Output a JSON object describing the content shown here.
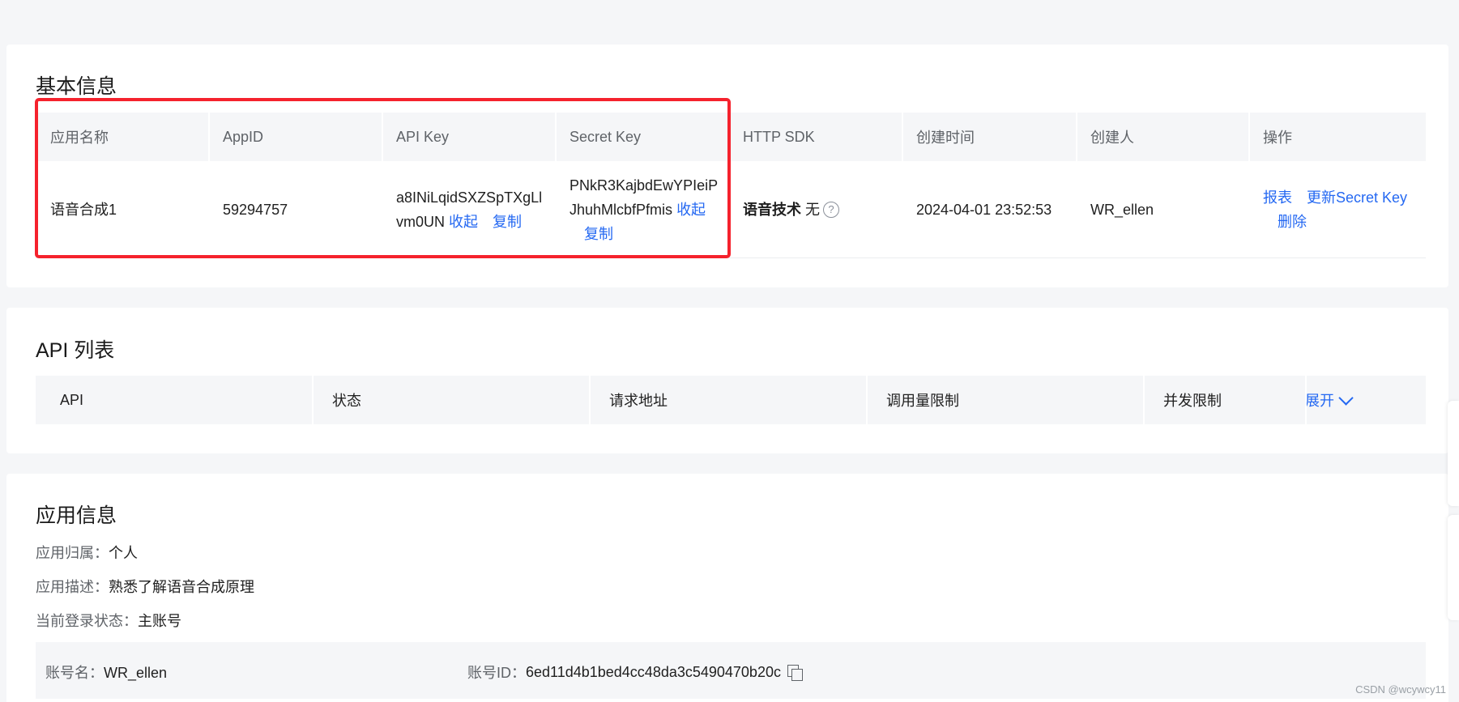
{
  "basic": {
    "title": "基本信息",
    "headers": [
      "应用名称",
      "AppID",
      "API Key",
      "Secret Key",
      "HTTP SDK",
      "创建时间",
      "创建人",
      "操作"
    ],
    "row": {
      "app_name": "语音合成1",
      "app_id": "59294757",
      "api_key": "a8INiLqidSXZSpTXgLlvm0UN",
      "secret_key": "PNkR3KajbdEwYPIeiPJhuhMlcbfPfmis",
      "collapse_label": "收起",
      "copy_label": "复制",
      "sdk_name": "语音技术",
      "sdk_value": "无",
      "help_glyph": "?",
      "created_at": "2024-04-01 23:52:53",
      "creator": "WR_ellen",
      "action_report": "报表",
      "action_update_secret": "更新Secret Key",
      "action_delete": "删除"
    }
  },
  "api_list": {
    "title": "API 列表",
    "headers": [
      "API",
      "状态",
      "请求地址",
      "调用量限制",
      "并发限制"
    ],
    "expand_label": "展开"
  },
  "app_info": {
    "title": "应用信息",
    "owner_label": "应用归属：",
    "owner_value": "个人",
    "desc_label": "应用描述：",
    "desc_value": "熟悉了解语音合成原理",
    "login_label": "当前登录状态：",
    "login_value": "主账号",
    "account_name_label": "账号名：",
    "account_name_value": "WR_ellen",
    "account_id_label": "账号ID：",
    "account_id_value": "6ed11d4b1bed4cc48da3c5490470b20c"
  },
  "watermark": "CSDN @wcywcy11",
  "colors": {
    "link": "#2468f2",
    "highlight": "#f5222d",
    "header_bg": "#f5f6f8"
  }
}
